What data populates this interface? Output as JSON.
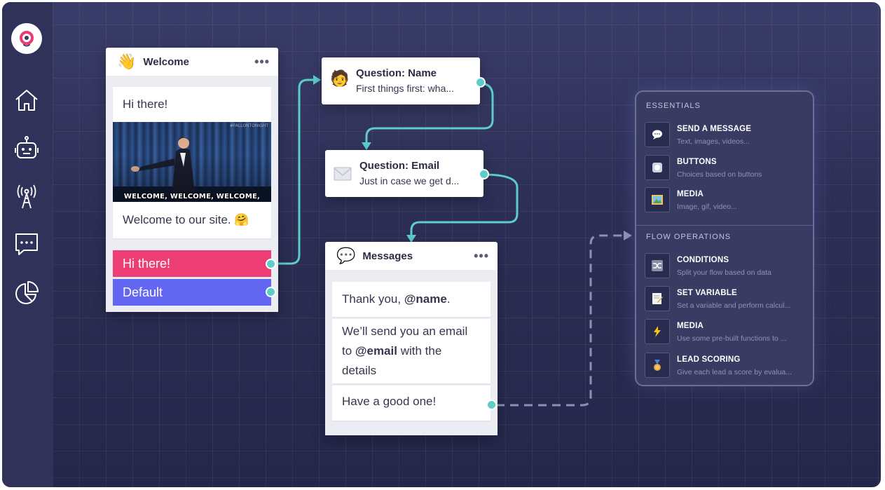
{
  "sidebar": {
    "logo": "chatbot-logo",
    "items": [
      {
        "icon": "home-icon"
      },
      {
        "icon": "robot-icon"
      },
      {
        "icon": "broadcast-icon"
      },
      {
        "icon": "chat-icon"
      },
      {
        "icon": "analytics-icon"
      }
    ]
  },
  "welcome": {
    "emoji": "👋",
    "title": "Welcome",
    "menu": "•••",
    "greeting": "Hi there!",
    "gif_caption": "WELCOME, WELCOME, WELCOME,",
    "gif_tag": "#FALLONTONIGHT",
    "message": "Welcome to our site. 🤗",
    "choices": [
      {
        "label": "Hi there!",
        "color": "#ec3d74"
      },
      {
        "label": "Default",
        "color": "#6366f1"
      }
    ]
  },
  "question_name": {
    "emoji": "🧑",
    "title": "Question: Name",
    "subtitle": "First things first: wha..."
  },
  "question_email": {
    "title": "Question: Email",
    "subtitle": "Just in case we get d..."
  },
  "messages": {
    "emoji": "💬",
    "title": "Messages",
    "menu": "•••",
    "m1_pre": "Thank you, ",
    "m1_var": "@name",
    "m1_post": ".",
    "m2_l1": "We’ll send you an email",
    "m2_pre": "to ",
    "m2_var": "@email",
    "m2_post": " with the",
    "m2_l3": "details",
    "m3": "Have a good one!"
  },
  "panel": {
    "essentials_title": "ESSENTIALS",
    "essentials": [
      {
        "icon": "speech-bubble-icon",
        "name": "SEND A MESSAGE",
        "desc": "Text, images, videos..."
      },
      {
        "icon": "button-icon",
        "name": "BUTTONS",
        "desc": "Choices based on buttons"
      },
      {
        "icon": "picture-icon",
        "name": "MEDIA",
        "desc": "Image, gif, video..."
      }
    ],
    "flow_title": "FLOW OPERATIONS",
    "flow": [
      {
        "icon": "shuffle-icon",
        "name": "CONDITIONS",
        "desc": "Split your flow based on data"
      },
      {
        "icon": "memo-icon",
        "name": "SET VARIABLE",
        "desc": "Set a variable and perform calcul..."
      },
      {
        "icon": "lightning-icon",
        "name": "MEDIA",
        "desc": "Use some pre-built functions to ..."
      },
      {
        "icon": "medal-icon",
        "name": "LEAD SCORING",
        "desc": "Give each lead a score by evalua..."
      }
    ]
  },
  "colors": {
    "connector": "#5ccdc9",
    "accent_pink": "#ec3d74",
    "accent_indigo": "#6366f1"
  }
}
